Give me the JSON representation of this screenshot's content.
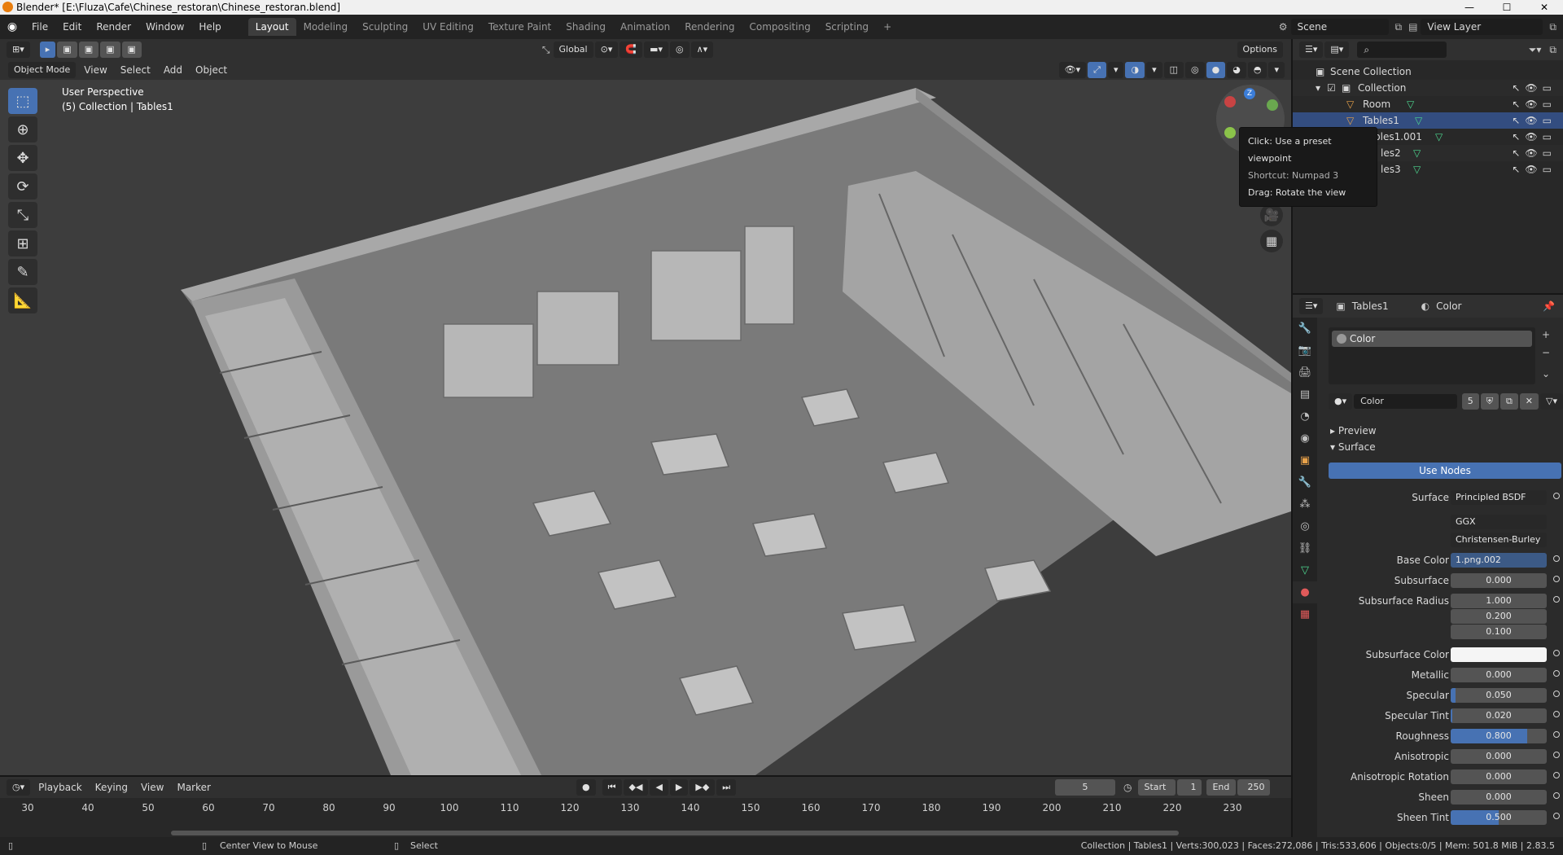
{
  "window": {
    "title": "Blender* [E:\\Fluza\\Cafe\\Chinese_restoran\\Chinese_restoran.blend]",
    "controls": [
      "—",
      "☐",
      "✕"
    ]
  },
  "menubar": {
    "menus": [
      "File",
      "Edit",
      "Render",
      "Window",
      "Help"
    ],
    "workspaces": [
      "Layout",
      "Modeling",
      "Sculpting",
      "UV Editing",
      "Texture Paint",
      "Shading",
      "Animation",
      "Rendering",
      "Compositing",
      "Scripting"
    ],
    "active_workspace": "Layout",
    "add_tab": "+",
    "scene": "Scene",
    "view_layer": "View Layer"
  },
  "viewport_header": {
    "transform_orientation": "Global",
    "options": "Options",
    "mode": "Object Mode",
    "menus": [
      "View",
      "Select",
      "Add",
      "Object"
    ]
  },
  "viewport": {
    "perspective_label": "User Perspective",
    "collection_label": "(5) Collection | Tables1",
    "gizmo_axis_label": "Z",
    "tooltip": {
      "line1": "Click: Use a preset viewpoint",
      "line2": "Shortcut: Numpad 3",
      "line3": "Drag: Rotate the view"
    }
  },
  "outliner": {
    "rows": [
      {
        "label": "Scene Collection"
      },
      {
        "label": "Collection"
      },
      {
        "label": "Room"
      },
      {
        "label": "Tables1"
      },
      {
        "label": "bles1.001"
      },
      {
        "label": "les2"
      },
      {
        "label": "les3"
      }
    ]
  },
  "properties": {
    "header_object": "Tables1",
    "header_material": "Color",
    "slot_name": "Color",
    "material_name": "Color",
    "material_users": "5",
    "section_preview": "Preview",
    "section_surface": "Surface",
    "use_nodes": "Use Nodes",
    "fields": {
      "surface_label": "Surface",
      "surface_value": "Principled BSDF",
      "distribution": "GGX",
      "subsurface_method": "Christensen-Burley",
      "base_color_label": "Base Color",
      "base_color_value": "1.png.002",
      "subsurface_label": "Subsurface",
      "subsurface_value": "0.000",
      "subsurface_radius_label": "Subsurface Radius",
      "subsurface_radius_x": "1.000",
      "subsurface_radius_y": "0.200",
      "subsurface_radius_z": "0.100",
      "subsurface_color_label": "Subsurface Color",
      "metallic_label": "Metallic",
      "metallic_value": "0.000",
      "specular_label": "Specular",
      "specular_value": "0.050",
      "specular_tint_label": "Specular Tint",
      "specular_tint_value": "0.020",
      "roughness_label": "Roughness",
      "roughness_value": "0.800",
      "anisotropic_label": "Anisotropic",
      "anisotropic_value": "0.000",
      "anisotropic_rotation_label": "Anisotropic Rotation",
      "anisotropic_rotation_value": "0.000",
      "sheen_label": "Sheen",
      "sheen_value": "0.000",
      "sheen_tint_label": "Sheen Tint",
      "sheen_tint_value": "0.500"
    },
    "slider_levels": {
      "specular": 0.05,
      "specular_tint": 0.02,
      "roughness": 0.8,
      "sheen_tint": 0.5
    }
  },
  "timeline": {
    "menus": [
      "Playback",
      "Keying",
      "View",
      "Marker"
    ],
    "current_frame": "5",
    "start_label": "Start",
    "start_value": "1",
    "end_label": "End",
    "end_value": "250",
    "ticks": [
      "30",
      "40",
      "50",
      "60",
      "70",
      "80",
      "90",
      "100",
      "110",
      "120",
      "130",
      "140",
      "150",
      "160",
      "170",
      "180",
      "190",
      "200",
      "210",
      "220",
      "230"
    ]
  },
  "statusbar": {
    "hint1": "Center View to Mouse",
    "hint2": "Select",
    "stats": "Collection | Tables1 | Verts:300,023 | Faces:272,086 | Tris:533,606 | Objects:0/5 | Mem: 501.8 MiB | 2.83.5"
  },
  "colors": {
    "accent": "#4772b3",
    "viewport_bg": "#3d3d3d",
    "object_icon": "#e8a24a",
    "mesh_icon": "#4dd68f",
    "active_material_tab": "#e05a5a"
  }
}
